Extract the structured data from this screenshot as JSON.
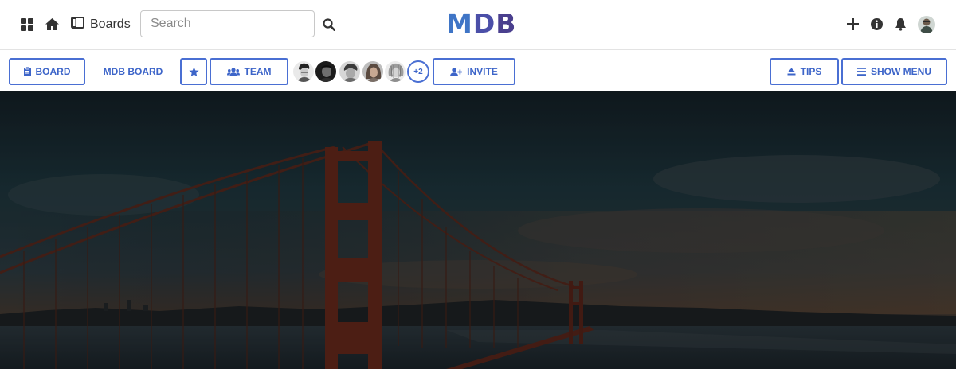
{
  "navbar": {
    "boards_label": "Boards",
    "search_placeholder": "Search",
    "logo": {
      "part1": "M",
      "part2": "D",
      "part3": "B"
    },
    "icons": [
      "grid-icon",
      "home-icon",
      "boards-icon",
      "search-icon",
      "plus-icon",
      "info-icon",
      "bell-icon"
    ]
  },
  "toolbar": {
    "board_button": "Board",
    "board_name": "MDB Board",
    "team_button": "Team",
    "more_members": "+2",
    "invite_button": "Invite",
    "tips_button": "Tips",
    "show_menu_button": "Show menu"
  },
  "colors": {
    "accent": "#3d65c9",
    "logo_blue": "#3f75c6",
    "logo_purple": "#4a3f8e"
  }
}
